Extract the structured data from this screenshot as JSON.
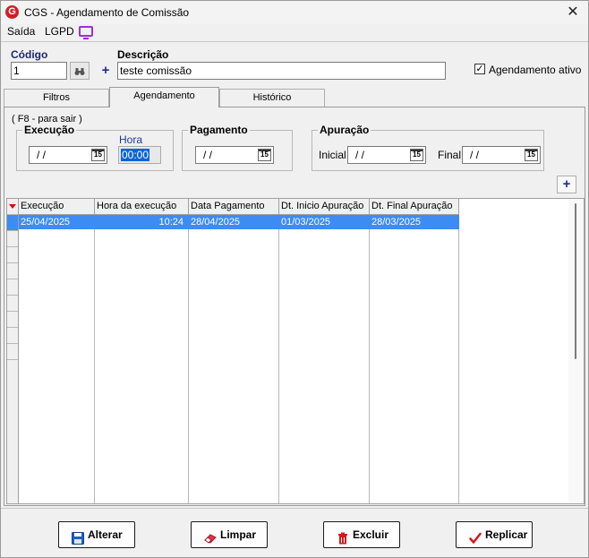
{
  "window": {
    "title": "CGS - Agendamento de Comissão",
    "close_glyph": "✕"
  },
  "menu": {
    "items": [
      "Saída",
      "LGPD"
    ]
  },
  "header": {
    "codigo_label": "Código",
    "codigo_value": "1",
    "descricao_label": "Descrição",
    "descricao_value": "teste comissão",
    "ativo_label": "Agendamento ativo",
    "ativo_checked": true
  },
  "tabs": [
    {
      "label": "Filtros"
    },
    {
      "label": "Agendamento"
    },
    {
      "label": "Histórico"
    }
  ],
  "agendamento": {
    "hint": "( F8 - para sair )",
    "execucao": {
      "title": "Execução",
      "date": "/ /",
      "hora_label": "Hora",
      "hora_value": "00:00"
    },
    "pagamento": {
      "title": "Pagamento",
      "date": "/ /"
    },
    "apuracao": {
      "title": "Apuração",
      "inicial_label": "Inicial",
      "inicial_date": "/ /",
      "final_label": "Final",
      "final_date": "/ /"
    },
    "calendar_glyph": "15"
  },
  "grid": {
    "columns": [
      "Execução",
      "Hora da execução",
      "Data Pagamento",
      "Dt. Inicio Apuração",
      "Dt. Final Apuração"
    ],
    "rows": [
      [
        "25/04/2025",
        "10:24",
        "28/04/2025",
        "01/03/2025",
        "28/03/2025"
      ]
    ]
  },
  "buttons": {
    "alterar": "Alterar",
    "limpar": "Limpar",
    "excluir": "Excluir",
    "replicar": "Replicar"
  },
  "colors": {
    "selection": "#3c8cf3",
    "accent_plus": "#1c2f8a",
    "logo": "#d11f27",
    "lgpd_icon": "#9b30d9"
  }
}
